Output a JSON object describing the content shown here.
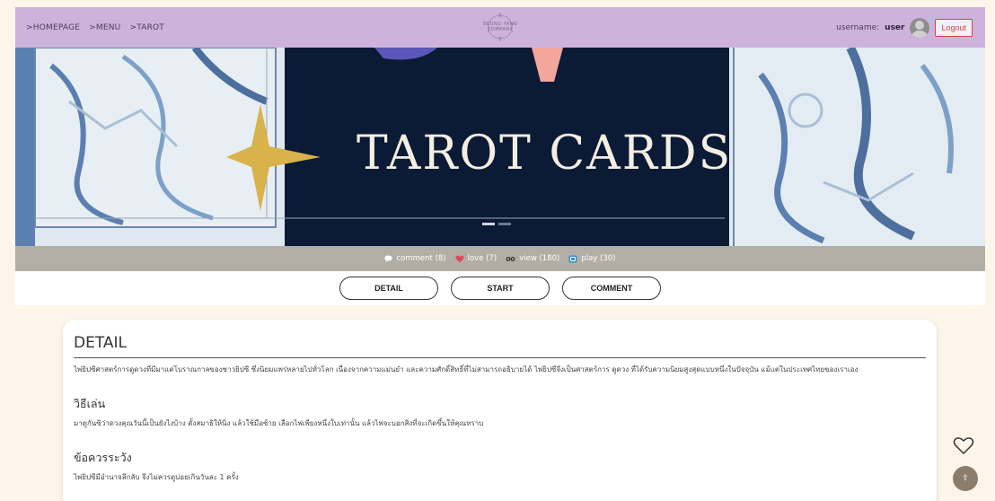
{
  "nav": {
    "breadcrumbs": [
      ">HOMEPAGE",
      ">MENU",
      ">TAROT"
    ],
    "logo_text_line1": "SOUNG YANG",
    "logo_text_line2": "COMPANY",
    "username_label": "username:",
    "username_value": "user",
    "logout_label": "Logout"
  },
  "banner": {
    "title": "TAROT CARDS"
  },
  "stats": {
    "comment": "comment (8)",
    "love": "love (7)",
    "view": "view (180)",
    "play": "play (30)"
  },
  "tabs": {
    "detail": "DETAIL",
    "start": "START",
    "comment": "COMMENT"
  },
  "detail": {
    "heading": "DETAIL",
    "description": "ไพ่ยิปซีศาสตร์การดูดวงที่มีมาแต่โบราณกาลของชาวยิปซี ซึ่งนิยมแพร่หลายไปทั่วโลก เนื่องจากความแม่นยำ และความศักดิ์สิทธิ์ที่ไม่สามารถอธิบายได้ ไพ่ยิปซีจึงเป็นศาสตร์การ ดูดวง ที่ได้รับความนิยมสูงสุดแบบหนึ่งในปัจจุบัน แม้แต่ในประเทศไทยของเราเอง",
    "howto_heading": "วิธีเล่น",
    "howto_text": "มาดูกันซิว่าดวงคุณวันนี้เป็นยังไงบ้าง ตั้งสมาธิให้นิ่ง แล้วใช้มือซ้าย เลือกไพ่เพียงหนึ่งใบเท่านั้น แล้วไพ่จะบอกสิ่งที่จะเกิดขึ้นให้คุณทราบ",
    "caution_heading": "ข้อควรระวัง",
    "caution_text": "ไพ่ยิปซีมีอำนาจลึกลับ จึงไม่ควรดูบ่อยเกินวันละ 1 ครั้ง"
  },
  "colors": {
    "nav_bg": "#cdb3dc",
    "banner_bg": "#0b1a35",
    "stats_bg": "#b3aea5",
    "page_bg": "#fdf5ea",
    "logout": "#d64545"
  }
}
